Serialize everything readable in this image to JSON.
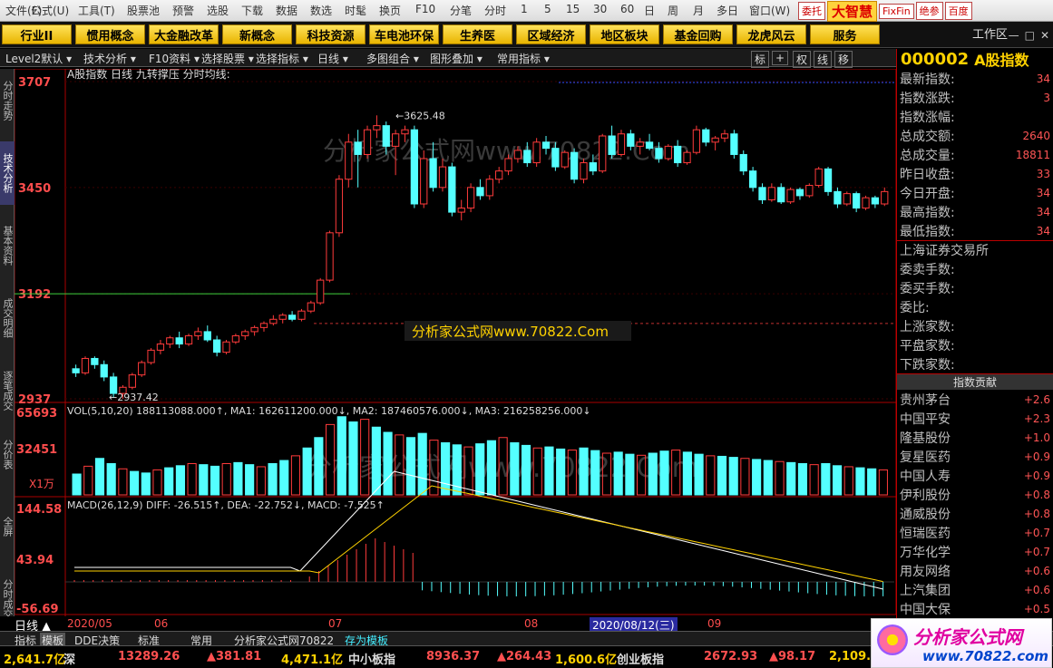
{
  "menubar": {
    "items": [
      "文件(F)",
      "公式(U)",
      "工具(T)",
      "股票池",
      "预警",
      "选股",
      "下载",
      "数据",
      "数选",
      "时髦",
      "换页",
      "F10",
      "分笔",
      "分时",
      "1",
      "5",
      "15",
      "30",
      "60",
      "日",
      "周",
      "月",
      "多日",
      "窗口(W)"
    ],
    "chips": [
      "委托",
      "大智慧",
      "FixFin",
      "绝参",
      "百度"
    ]
  },
  "blocks": [
    "行业II",
    "惯用概念",
    "大金融改革",
    "新概念",
    "科技资源",
    "车电池环保",
    "生养医",
    "区域经济",
    "地区板块",
    "基金回购",
    "龙虎风云",
    "服务"
  ],
  "workarea": "工作区",
  "toolrow": {
    "items": [
      "Level2默认",
      "技术分析",
      "F10资料",
      "选择股票",
      "选择指标",
      "日线",
      "多图组合",
      "图形叠加",
      "常用指标"
    ],
    "right": [
      "标",
      "+",
      "权",
      "线",
      "移"
    ]
  },
  "lefttabs": [
    "分时走势",
    "技术分析",
    "基本资料",
    "成交明细",
    "逐笔成交",
    "分价表",
    "全屏",
    "分时成交"
  ],
  "header": {
    "title": "A股指数 日线 九转撑压 分时均线:",
    "code": "000002",
    "name": "A股指数"
  },
  "price_axis": {
    "labels": [
      "3707",
      "3450",
      "3192",
      "2937"
    ]
  },
  "annotations": {
    "high": "3625.48",
    "low": "2937.42"
  },
  "watermark": "分析家公式网www.70822.Com",
  "vol": {
    "label": "VOL(5,10,20) 188113088.000↑, MA1: 162611200.000↓, MA2: 187460576.000↓, MA3: 216258256.000↓",
    "axis": [
      "65693",
      "32451"
    ],
    "unit": "X1万"
  },
  "macd": {
    "label": "MACD(26,12,9) DIFF: -26.515↑, DEA: -22.752↓, MACD: -7.525↑",
    "axis": [
      "144.58",
      "43.94",
      "-56.69"
    ]
  },
  "dates": [
    "2020/05",
    "06",
    "07",
    "08",
    "2020/08/12(三)",
    "09"
  ],
  "rightpanel": {
    "stats": [
      [
        "最新指数:",
        "34"
      ],
      [
        "指数涨跌:",
        "3"
      ],
      [
        "指数涨幅:",
        ""
      ],
      [
        "总成交额:",
        "2640"
      ],
      [
        "总成交量:",
        "18811"
      ],
      [
        "昨日收盘:",
        "33"
      ],
      [
        "今日开盘:",
        "34"
      ],
      [
        "最高指数:",
        "34"
      ],
      [
        "最低指数:",
        "34"
      ]
    ],
    "exchange": "上海证券交易所",
    "stats2": [
      [
        "委卖手数:",
        ""
      ],
      [
        "委买手数:",
        ""
      ],
      [
        "委比:",
        ""
      ],
      [
        "上涨家数:",
        ""
      ],
      [
        "平盘家数:",
        ""
      ],
      [
        "下跌家数:",
        ""
      ]
    ],
    "contrib_title": "指数贡献",
    "contrib": [
      [
        "贵州茅台",
        "+2.6"
      ],
      [
        "中国平安",
        "+2.3"
      ],
      [
        "隆基股份",
        "+1.0"
      ],
      [
        "复星医药",
        "+0.9"
      ],
      [
        "中国人寿",
        "+0.9"
      ],
      [
        "伊利股份",
        "+0.8"
      ],
      [
        "通威股份",
        "+0.8"
      ],
      [
        "恒瑞医药",
        "+0.7"
      ],
      [
        "万华化学",
        "+0.7"
      ],
      [
        "用友网络",
        "+0.6"
      ],
      [
        "上汽集团",
        "+0.6"
      ],
      [
        "中国大保",
        "+0.5"
      ]
    ]
  },
  "bottom": {
    "period": "日线",
    "tabs": [
      "指标",
      "模板",
      "DDE决策",
      "标准",
      "常用",
      "分析家公式网70822",
      "存为模板"
    ]
  },
  "status": [
    [
      "2,641.7亿",
      "深"
    ],
    [
      "13289.26",
      "▲381.81"
    ],
    [
      "4,471.1亿",
      "中小板指"
    ],
    [
      "8936.37",
      "▲264.43"
    ],
    [
      "1,600.6亿",
      "创业板指"
    ],
    [
      "2672.93",
      "▲98.17"
    ],
    [
      "2,109.",
      ""
    ]
  ],
  "logo": {
    "text": "分析家公式网",
    "url": "www.70822.com"
  },
  "colors": {
    "up": "#ff3b3b",
    "down": "#54ffff",
    "accent": "#ffd200"
  },
  "chart_data": {
    "type": "candlestick",
    "ohlc": [
      [
        3010,
        3020,
        2990,
        3000
      ],
      [
        3000,
        3040,
        2995,
        3035
      ],
      [
        3035,
        3040,
        3010,
        3020
      ],
      [
        3020,
        3030,
        2980,
        2990
      ],
      [
        2990,
        3000,
        2940,
        2950
      ],
      [
        2950,
        2970,
        2937,
        2965
      ],
      [
        2965,
        3000,
        2960,
        2995
      ],
      [
        2995,
        3030,
        2990,
        3025
      ],
      [
        3025,
        3060,
        3020,
        3055
      ],
      [
        3055,
        3080,
        3045,
        3070
      ],
      [
        3070,
        3090,
        3060,
        3085
      ],
      [
        3085,
        3100,
        3060,
        3070
      ],
      [
        3070,
        3095,
        3065,
        3090
      ],
      [
        3090,
        3110,
        3080,
        3100
      ],
      [
        3100,
        3115,
        3075,
        3080
      ],
      [
        3080,
        3090,
        3040,
        3050
      ],
      [
        3050,
        3080,
        3045,
        3075
      ],
      [
        3075,
        3095,
        3070,
        3090
      ],
      [
        3090,
        3105,
        3080,
        3100
      ],
      [
        3100,
        3115,
        3090,
        3110
      ],
      [
        3110,
        3125,
        3100,
        3120
      ],
      [
        3120,
        3140,
        3115,
        3130
      ],
      [
        3130,
        3145,
        3120,
        3140
      ],
      [
        3140,
        3150,
        3125,
        3130
      ],
      [
        3130,
        3155,
        3125,
        3150
      ],
      [
        3150,
        3175,
        3145,
        3170
      ],
      [
        3170,
        3230,
        3165,
        3225
      ],
      [
        3225,
        3345,
        3220,
        3340
      ],
      [
        3340,
        3480,
        3330,
        3470
      ],
      [
        3470,
        3580,
        3450,
        3560
      ],
      [
        3560,
        3590,
        3450,
        3530
      ],
      [
        3530,
        3600,
        3520,
        3590
      ],
      [
        3590,
        3625,
        3570,
        3600
      ],
      [
        3600,
        3610,
        3530,
        3550
      ],
      [
        3550,
        3590,
        3480,
        3580
      ],
      [
        3580,
        3600,
        3560,
        3590
      ],
      [
        3590,
        3600,
        3400,
        3410
      ],
      [
        3410,
        3540,
        3400,
        3520
      ],
      [
        3520,
        3560,
        3440,
        3450
      ],
      [
        3450,
        3520,
        3440,
        3500
      ],
      [
        3500,
        3510,
        3380,
        3390
      ],
      [
        3390,
        3420,
        3370,
        3400
      ],
      [
        3400,
        3460,
        3390,
        3450
      ],
      [
        3450,
        3470,
        3420,
        3430
      ],
      [
        3430,
        3480,
        3420,
        3470
      ],
      [
        3470,
        3500,
        3460,
        3490
      ],
      [
        3490,
        3530,
        3480,
        3520
      ],
      [
        3520,
        3550,
        3510,
        3540
      ],
      [
        3540,
        3560,
        3500,
        3510
      ],
      [
        3510,
        3570,
        3500,
        3560
      ],
      [
        3560,
        3575,
        3530,
        3545
      ],
      [
        3545,
        3560,
        3490,
        3500
      ],
      [
        3500,
        3540,
        3495,
        3535
      ],
      [
        3535,
        3545,
        3460,
        3470
      ],
      [
        3470,
        3520,
        3460,
        3510
      ],
      [
        3510,
        3530,
        3480,
        3490
      ],
      [
        3490,
        3580,
        3485,
        3575
      ],
      [
        3575,
        3600,
        3520,
        3530
      ],
      [
        3530,
        3590,
        3525,
        3580
      ],
      [
        3580,
        3590,
        3540,
        3550
      ],
      [
        3550,
        3570,
        3530,
        3560
      ],
      [
        3560,
        3580,
        3540,
        3545
      ],
      [
        3545,
        3560,
        3510,
        3520
      ],
      [
        3520,
        3555,
        3515,
        3550
      ],
      [
        3550,
        3565,
        3500,
        3510
      ],
      [
        3510,
        3540,
        3505,
        3535
      ],
      [
        3535,
        3600,
        3530,
        3590
      ],
      [
        3590,
        3595,
        3550,
        3560
      ],
      [
        3560,
        3575,
        3540,
        3570
      ],
      [
        3570,
        3590,
        3560,
        3580
      ],
      [
        3580,
        3590,
        3520,
        3530
      ],
      [
        3530,
        3540,
        3480,
        3490
      ],
      [
        3490,
        3500,
        3440,
        3450
      ],
      [
        3450,
        3460,
        3410,
        3420
      ],
      [
        3420,
        3460,
        3415,
        3450
      ],
      [
        3450,
        3460,
        3410,
        3415
      ],
      [
        3415,
        3450,
        3410,
        3445
      ],
      [
        3445,
        3450,
        3420,
        3430
      ],
      [
        3430,
        3460,
        3425,
        3455
      ],
      [
        3455,
        3500,
        3450,
        3495
      ],
      [
        3495,
        3500,
        3430,
        3440
      ],
      [
        3440,
        3450,
        3400,
        3410
      ],
      [
        3410,
        3440,
        3405,
        3435
      ],
      [
        3435,
        3440,
        3390,
        3400
      ],
      [
        3400,
        3430,
        3395,
        3425
      ],
      [
        3425,
        3430,
        3400,
        3410
      ],
      [
        3410,
        3450,
        3405,
        3440
      ]
    ],
    "vol_levels": [
      40,
      55,
      70,
      60,
      50,
      45,
      42,
      48,
      52,
      56,
      60,
      58,
      55,
      60,
      62,
      58,
      54,
      60,
      66,
      75,
      90,
      110,
      135,
      150,
      140,
      145,
      130,
      120,
      115,
      110,
      118,
      105,
      100,
      96,
      92,
      98,
      104,
      110,
      100,
      95,
      90,
      92,
      88,
      86,
      90,
      85,
      80,
      82,
      78,
      76,
      80,
      84,
      86,
      82,
      78,
      75,
      74,
      72,
      70,
      68,
      66,
      64,
      62,
      60,
      58,
      60,
      56,
      54,
      52,
      50,
      48
    ],
    "ylim": [
      2937,
      3707
    ]
  }
}
